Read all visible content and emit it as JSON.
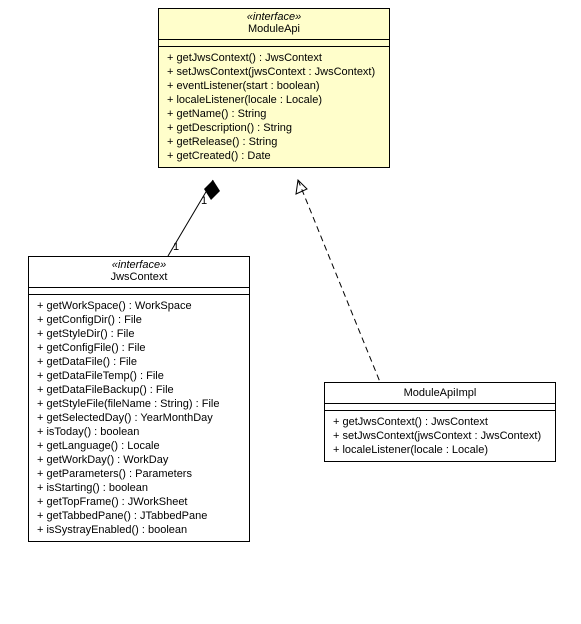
{
  "moduleApi": {
    "stereotype": "«interface»",
    "name": "ModuleApi",
    "ops": [
      "+ getJwsContext() : JwsContext",
      "+ setJwsContext(jwsContext : JwsContext)",
      "+ eventListener(start : boolean)",
      "+ localeListener(locale : Locale)",
      "+ getName() : String",
      "+ getDescription() : String",
      "+ getRelease() : String",
      "+ getCreated() : Date"
    ]
  },
  "jwsContext": {
    "stereotype": "«interface»",
    "name": "JwsContext",
    "ops": [
      "+ getWorkSpace() : WorkSpace",
      "+ getConfigDir() : File",
      "+ getStyleDir() : File",
      "+ getConfigFile() : File",
      "+ getDataFile() : File",
      "+ getDataFileTemp() : File",
      "+ getDataFileBackup() : File",
      "+ getStyleFile(fileName : String) : File",
      "+ getSelectedDay() : YearMonthDay",
      "+ isToday() : boolean",
      "+ getLanguage() : Locale",
      "+ getWorkDay() : WorkDay",
      "+ getParameters() : Parameters",
      "+ isStarting() : boolean",
      "+ getTopFrame() : JWorkSheet",
      "+ getTabbedPane() : JTabbedPane",
      "+ isSystrayEnabled() : boolean"
    ]
  },
  "moduleApiImpl": {
    "name": "ModuleApiImpl",
    "ops": [
      "+ getJwsContext() : JwsContext",
      "+ setJwsContext(jwsContext : JwsContext)",
      "+ localeListener(locale : Locale)"
    ]
  },
  "multiplicity": {
    "a": "1",
    "b": "1"
  }
}
